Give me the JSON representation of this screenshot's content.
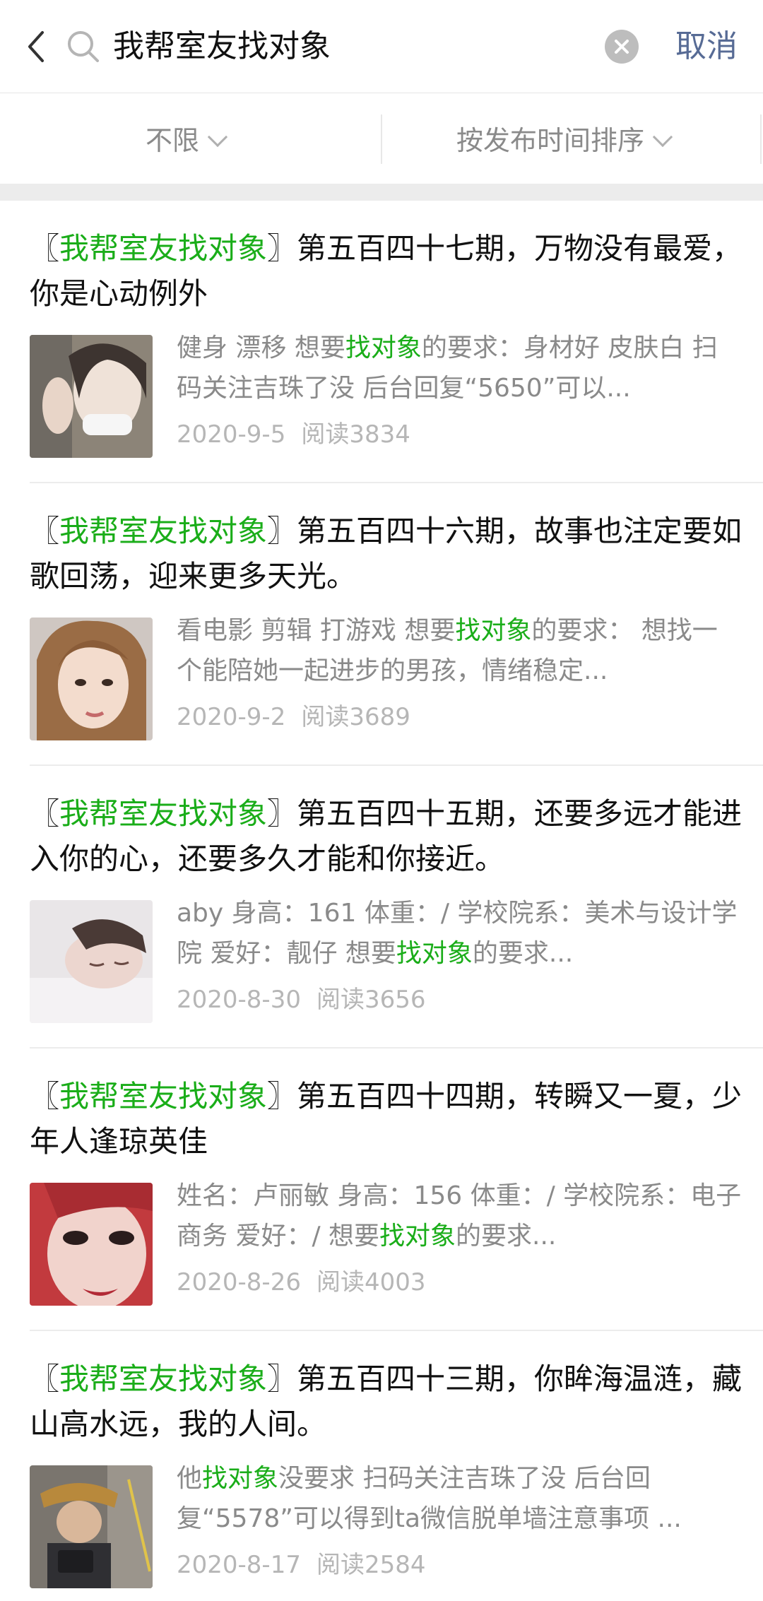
{
  "search": {
    "query": "我帮室友找对象",
    "cancel_label": "取消"
  },
  "filters": {
    "range_label": "不限",
    "sort_label": "按发布时间排序"
  },
  "colors": {
    "highlight": "#1aad19",
    "link": "#576b95",
    "secondary_text": "#8a8a8a",
    "meta_text": "#b6b6b6"
  },
  "results": [
    {
      "title_prefix": "〖",
      "title_highlight": "我帮室友找对象",
      "title_suffix": "〗第五百四十七期，万物没有最爱，你是心动例外",
      "desc_before": "健身 漂移 想要",
      "desc_highlight": "找对象",
      "desc_after": "的要求：身材好 皮肤白 扫码关注吉珠了没 后台回复“5650”可以...",
      "date": "2020-9-5",
      "reads": "阅读3834"
    },
    {
      "title_prefix": "〖",
      "title_highlight": "我帮室友找对象",
      "title_suffix": "〗第五百四十六期，故事也注定要如歌回荡，迎来更多天光。",
      "desc_before": "看电影 剪辑 打游戏 想要",
      "desc_highlight": "找对象",
      "desc_after": "的要求： 想找一个能陪她一起进步的男孩，情绪稳定...",
      "date": "2020-9-2",
      "reads": "阅读3689"
    },
    {
      "title_prefix": "〖",
      "title_highlight": "我帮室友找对象",
      "title_suffix": "〗第五百四十五期，还要多远才能进入你的心，还要多久才能和你接近。",
      "desc_before": "aby 身高：161 体重：/ 学校院系：美术与设计学院 爱好：靓仔 想要",
      "desc_highlight": "找对象",
      "desc_after": "的要求...",
      "date": "2020-8-30",
      "reads": "阅读3656"
    },
    {
      "title_prefix": "〖",
      "title_highlight": "我帮室友找对象",
      "title_suffix": "〗第五百四十四期，转瞬又一夏，少年人逢琼英佳",
      "desc_before": "姓名：卢丽敏 身高：156 体重：/ 学校院系：电子商务 爱好：/ 想要",
      "desc_highlight": "找对象",
      "desc_after": "的要求...",
      "date": "2020-8-26",
      "reads": "阅读4003"
    },
    {
      "title_prefix": "〖",
      "title_highlight": "我帮室友找对象",
      "title_suffix": "〗第五百四十三期，你眸海温涟，藏山高水远，我的人间。",
      "desc_before": "他",
      "desc_highlight": "找对象",
      "desc_after": "没要求 扫码关注吉珠了没 后台回复“5578”可以得到ta微信脱单墙注意事项 ...",
      "date": "2020-8-17",
      "reads": "阅读2584"
    }
  ]
}
